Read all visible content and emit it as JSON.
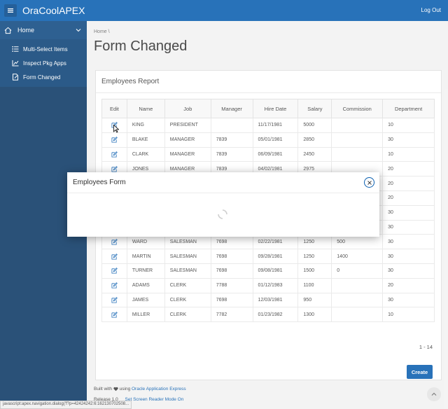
{
  "header": {
    "app_title": "OraCoolAPEX",
    "logout_label": "Log Out"
  },
  "sidebar": {
    "home_label": "Home",
    "items": [
      {
        "label": "Multi-Select Items",
        "icon": "list-icon"
      },
      {
        "label": "Inspect Pkg Apps",
        "icon": "chart-icon"
      },
      {
        "label": "Form Changed",
        "icon": "form-icon"
      }
    ]
  },
  "breadcrumb": {
    "home": "Home"
  },
  "page_title": "Form Changed",
  "report": {
    "title": "Employees Report",
    "columns": [
      "Edit",
      "Name",
      "Job",
      "Manager",
      "Hire Date",
      "Salary",
      "Commission",
      "Department"
    ],
    "rows": [
      {
        "name": "KING",
        "job": "PRESIDENT",
        "manager": "",
        "hiredate": "11/17/1981",
        "salary": "5000",
        "commission": "",
        "dept": "10"
      },
      {
        "name": "BLAKE",
        "job": "MANAGER",
        "manager": "7839",
        "hiredate": "05/01/1981",
        "salary": "2850",
        "commission": "",
        "dept": "30"
      },
      {
        "name": "CLARK",
        "job": "MANAGER",
        "manager": "7839",
        "hiredate": "06/09/1981",
        "salary": "2450",
        "commission": "",
        "dept": "10"
      },
      {
        "name": "JONES",
        "job": "MANAGER",
        "manager": "7839",
        "hiredate": "04/02/1981",
        "salary": "2975",
        "commission": "",
        "dept": "20"
      },
      {
        "name": "",
        "job": "",
        "manager": "",
        "hiredate": "",
        "salary": "",
        "commission": "",
        "dept": "20"
      },
      {
        "name": "",
        "job": "",
        "manager": "",
        "hiredate": "",
        "salary": "",
        "commission": "",
        "dept": "20"
      },
      {
        "name": "",
        "job": "",
        "manager": "",
        "hiredate": "",
        "salary": "",
        "commission": "",
        "dept": "30"
      },
      {
        "name": "",
        "job": "",
        "manager": "",
        "hiredate": "",
        "salary": "",
        "commission": "",
        "dept": "30"
      },
      {
        "name": "WARD",
        "job": "SALESMAN",
        "manager": "7698",
        "hiredate": "02/22/1981",
        "salary": "1250",
        "commission": "500",
        "dept": "30"
      },
      {
        "name": "MARTIN",
        "job": "SALESMAN",
        "manager": "7698",
        "hiredate": "09/28/1981",
        "salary": "1250",
        "commission": "1400",
        "dept": "30"
      },
      {
        "name": "TURNER",
        "job": "SALESMAN",
        "manager": "7698",
        "hiredate": "09/08/1981",
        "salary": "1500",
        "commission": "0",
        "dept": "30"
      },
      {
        "name": "ADAMS",
        "job": "CLERK",
        "manager": "7788",
        "hiredate": "01/12/1983",
        "salary": "1100",
        "commission": "",
        "dept": "20"
      },
      {
        "name": "JAMES",
        "job": "CLERK",
        "manager": "7698",
        "hiredate": "12/03/1981",
        "salary": "950",
        "commission": "",
        "dept": "30"
      },
      {
        "name": "MILLER",
        "job": "CLERK",
        "manager": "7782",
        "hiredate": "01/23/1982",
        "salary": "1300",
        "commission": "",
        "dept": "10"
      }
    ],
    "pagination": "1 - 14",
    "create_label": "Create"
  },
  "footer": {
    "built_with": "Built with",
    "using": "using",
    "apex_link": "Oracle Application Express",
    "release": "Release 1.0",
    "screen_reader": "Set Screen Reader Mode On"
  },
  "status_url": "javascript:apex.navigation.dialog('f?p=42424242:6:162130702508...",
  "dialog": {
    "title": "Employees Form"
  },
  "colors": {
    "header_blue": "#0b5fb0",
    "sidebar_navy": "#0d3a66"
  }
}
